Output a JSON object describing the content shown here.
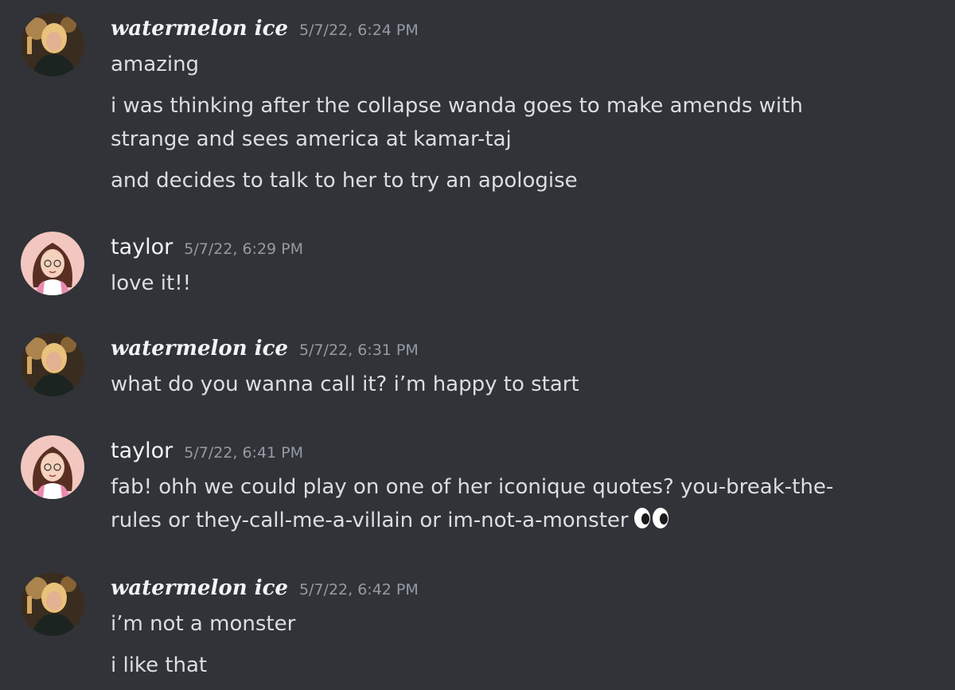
{
  "messages": [
    {
      "user": "watermelon ice",
      "avatar": "watermelon-avatar",
      "timestamp": "5/7/22, 6:24 PM",
      "lines": [
        "amazing",
        "i was thinking after the collapse wanda goes to make amends with",
        "strange and sees america at kamar-taj",
        "and decides to talk to her to try an apologise"
      ]
    },
    {
      "user": "taylor",
      "avatar": "taylor-avatar",
      "timestamp": "5/7/22, 6:29 PM",
      "lines": [
        "love it!!"
      ]
    },
    {
      "user": "watermelon ice",
      "avatar": "watermelon-avatar",
      "timestamp": "5/7/22, 6:31 PM",
      "lines": [
        "what do you wanna call it? i’m happy to start"
      ]
    },
    {
      "user": "taylor",
      "avatar": "taylor-avatar",
      "timestamp": "5/7/22, 6:41 PM",
      "lines": [
        "fab! ohh we could play on one of her iconique quotes? you-break-the-",
        "rules or they-call-me-a-villain or im-not-a-monster"
      ],
      "emoji": "eyes-emoji"
    },
    {
      "user": "watermelon ice",
      "avatar": "watermelon-avatar",
      "timestamp": "5/7/22, 6:42 PM",
      "lines": [
        "i’m not a monster",
        "i like that"
      ]
    }
  ],
  "colors": {
    "background": "#313338",
    "text": "#dbdee1",
    "username": "#f2f3f5",
    "timestamp": "#949ba4"
  }
}
